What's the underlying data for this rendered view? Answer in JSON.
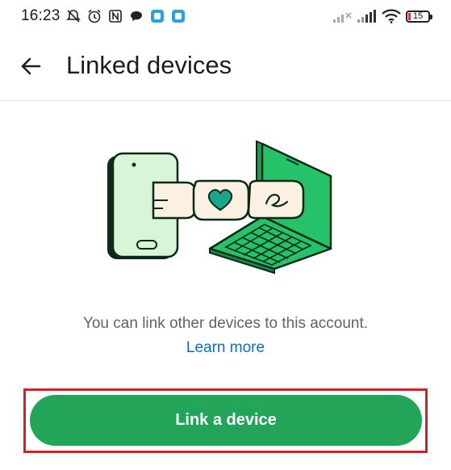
{
  "status_bar": {
    "time": "16:23",
    "battery_level": "15"
  },
  "header": {
    "title": "Linked devices"
  },
  "main": {
    "description": "You can link other devices to this account.",
    "learn_more": "Learn more",
    "primary_button_label": "Link a device"
  },
  "colors": {
    "accent_green": "#22a559",
    "link_blue": "#0b6fb8",
    "highlight_red": "#d4202a"
  }
}
